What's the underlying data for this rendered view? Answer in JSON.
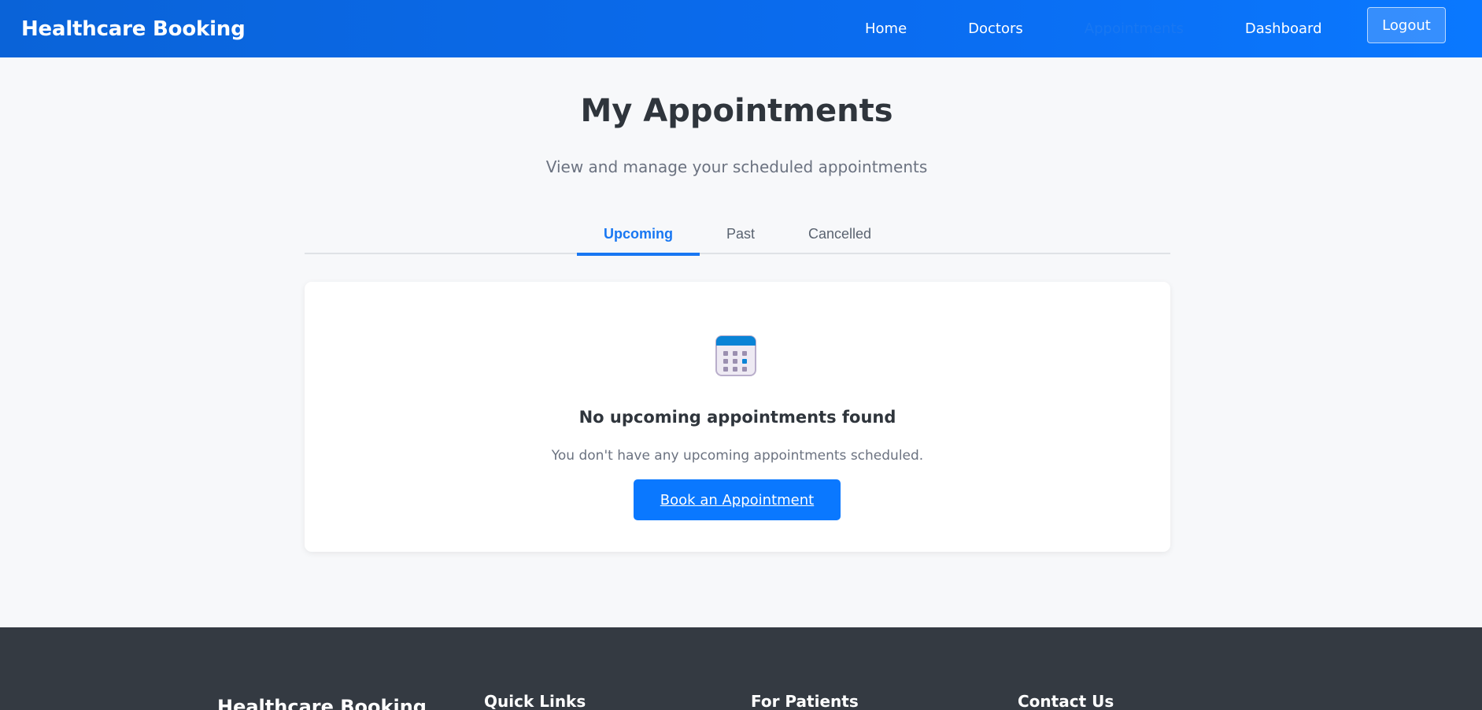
{
  "navbar": {
    "brand": "Healthcare Booking",
    "links": [
      {
        "label": "Home",
        "active": false
      },
      {
        "label": "Doctors",
        "active": false
      },
      {
        "label": "Appointments",
        "active": true
      },
      {
        "label": "Dashboard",
        "active": false
      }
    ],
    "logout_label": "Logout"
  },
  "page": {
    "title": "My Appointments",
    "subtitle": "View and manage your scheduled appointments"
  },
  "tabs": [
    {
      "label": "Upcoming",
      "active": true
    },
    {
      "label": "Past",
      "active": false
    },
    {
      "label": "Cancelled",
      "active": false
    }
  ],
  "empty_state": {
    "icon": "calendar-icon",
    "title": "No upcoming appointments found",
    "text": "You don't have any upcoming appointments scheduled.",
    "button_label": "Book an Appointment"
  },
  "footer": {
    "brand": "Healthcare Booking",
    "headings": [
      "Quick Links",
      "For Patients",
      "Contact Us"
    ]
  },
  "colors": {
    "primary": "#0a78ff",
    "nav_gradient_start": "#0a63d8",
    "footer_bg": "#343a42",
    "page_bg": "#f7f8fa"
  }
}
